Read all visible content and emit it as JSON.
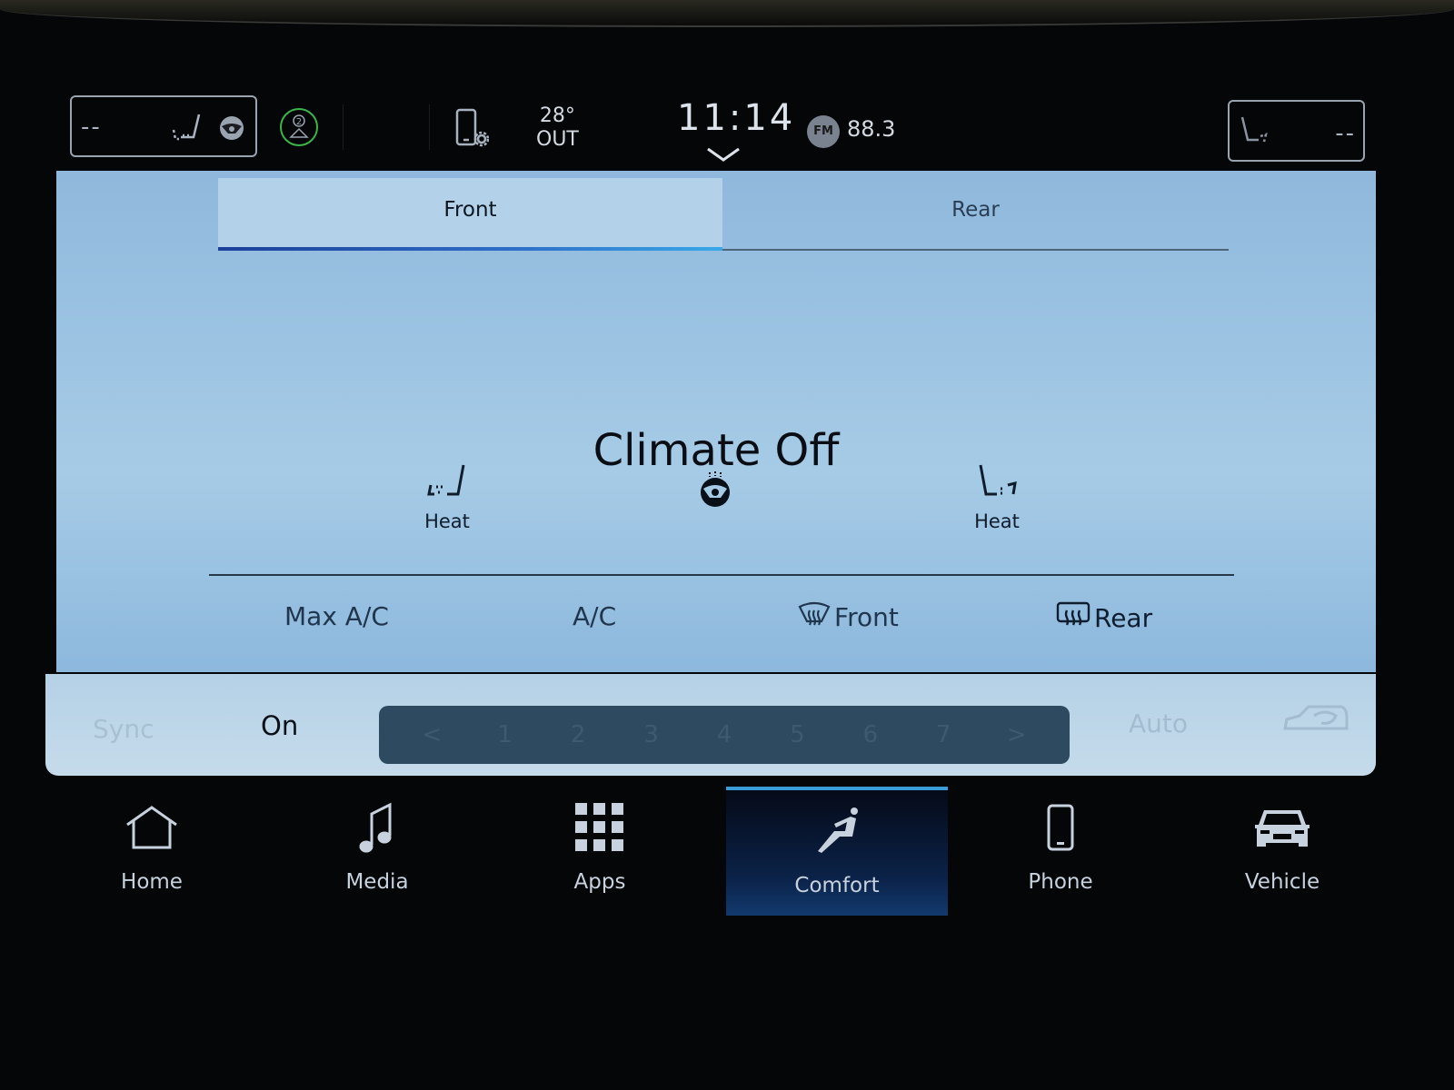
{
  "status_bar": {
    "left_seat_value": "--",
    "right_seat_value": "--",
    "driver_profile_number": "2",
    "outside_temp": "28°",
    "outside_label": "OUT",
    "clock": "11:14",
    "radio_band": "FM",
    "radio_frequency": "88.3"
  },
  "climate": {
    "tabs": [
      {
        "label": "Front",
        "active": true
      },
      {
        "label": "Rear",
        "active": false
      }
    ],
    "title": "Climate Off",
    "left_seat_label": "Heat",
    "right_seat_label": "Heat",
    "controls": [
      {
        "label": "Max A/C"
      },
      {
        "label": "A/C"
      },
      {
        "label": "Front",
        "icon": "front-defrost-icon"
      },
      {
        "label": "Rear",
        "icon": "rear-defrost-icon"
      }
    ],
    "fan_row": {
      "sync_label": "Sync",
      "on_label": "On",
      "fan_steps": [
        "<",
        "1",
        "2",
        "3",
        "4",
        "5",
        "6",
        "7",
        ">"
      ],
      "auto_label": "Auto"
    }
  },
  "nav": {
    "items": [
      {
        "label": "Home",
        "icon": "home-icon",
        "active": false
      },
      {
        "label": "Media",
        "icon": "music-note-icon",
        "active": false
      },
      {
        "label": "Apps",
        "icon": "apps-grid-icon",
        "active": false
      },
      {
        "label": "Comfort",
        "icon": "seated-person-icon",
        "active": true
      },
      {
        "label": "Phone",
        "icon": "phone-icon",
        "active": false
      },
      {
        "label": "Vehicle",
        "icon": "car-icon",
        "active": false
      }
    ]
  },
  "colors": {
    "panel_blue": "#9ec5e3",
    "active_tab_accent": "#2f6fc8",
    "driver_badge_green": "#3bb54a",
    "nav_active_blue": "#123a6e"
  }
}
